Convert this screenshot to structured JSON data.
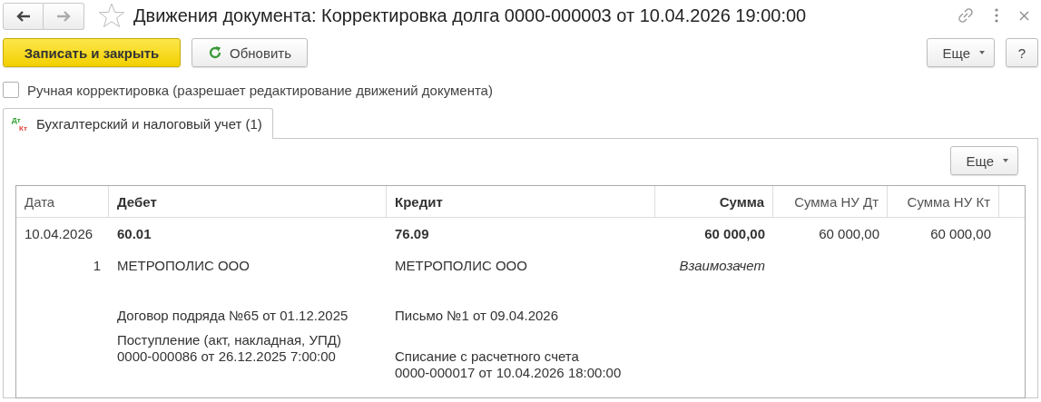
{
  "window": {
    "title": "Движения документа: Корректировка долга 0000-000003 от 10.04.2026 19:00:00",
    "favorite": false
  },
  "toolbar": {
    "primary": "Записать и закрыть",
    "refresh": "Обновить",
    "more": "Еще",
    "help": "?"
  },
  "manual_correction": {
    "label": "Ручная корректировка (разрешает редактирование движений документа)",
    "checked": false
  },
  "tabs": [
    {
      "icon_debit": "Дт",
      "icon_credit": "Кт",
      "label": "Бухгалтерский и налоговый учет (1)",
      "selected": true
    }
  ],
  "panel": {
    "more": "Еще"
  },
  "table": {
    "columns": [
      "Дата",
      "Дебет",
      "Кредит",
      "Сумма",
      "Сумма НУ Дт",
      "Сумма НУ Кт"
    ],
    "rows": [
      {
        "date": "10.04.2026",
        "number": "1",
        "debit": {
          "account": "60.01",
          "subconto": [
            "МЕТРОПОЛИС ООО",
            "Договор подряда №65 от 01.12.2025",
            "Поступление (акт, накладная, УПД)\n0000-000086 от 26.12.2025 7:00:00"
          ]
        },
        "credit": {
          "account": "76.09",
          "subconto": [
            "МЕТРОПОЛИС ООО",
            "Письмо №1 от 09.04.2026",
            "Списание с расчетного счета\n0000-000017 от 10.04.2026 18:00:00"
          ]
        },
        "amount": "60 000,00",
        "content": "Взаимозачет",
        "amount_nu_dt": "60 000,00",
        "amount_nu_kt": "60 000,00"
      }
    ]
  }
}
